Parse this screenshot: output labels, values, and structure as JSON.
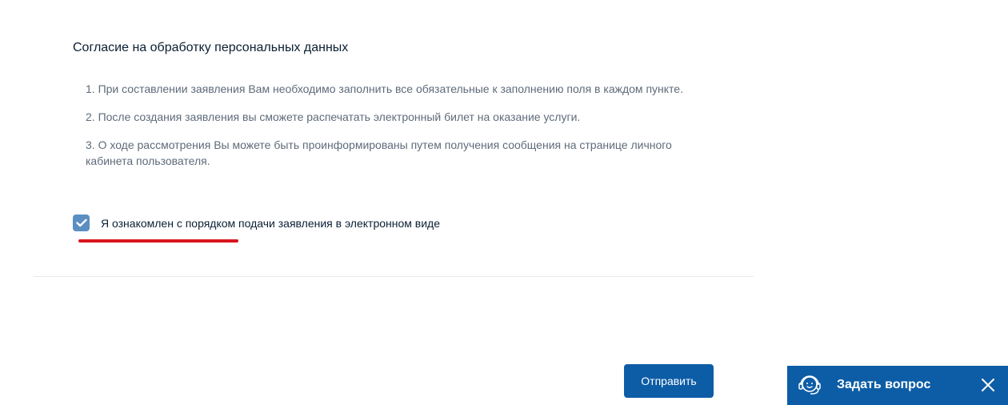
{
  "consent": {
    "title": "Согласие на обработку персональных данных",
    "rules": [
      "1. При составлении заявления Вам необходимо заполнить все обязательные к заполнению поля в каждом пункте.",
      "2. После создания заявления вы сможете распечатать электронный билет на оказание услуги.",
      "3. О ходе рассмотрения Вы можете быть проинформированы путем получения сообщения на странице личного кабинета пользователя."
    ],
    "agree_label": "Я ознакомлен с порядком подачи заявления в электронном виде",
    "agree_checked": true
  },
  "actions": {
    "submit_label": "Отправить"
  },
  "help_widget": {
    "label": "Задать вопрос",
    "icon": "support-operator-icon",
    "close_icon": "close-icon"
  },
  "colors": {
    "primary": "#0d5da6",
    "checkbox": "#5b8fc2",
    "highlight": "#d9151c",
    "text_dark": "#0b1f33",
    "text_muted": "#5e6b7a"
  }
}
